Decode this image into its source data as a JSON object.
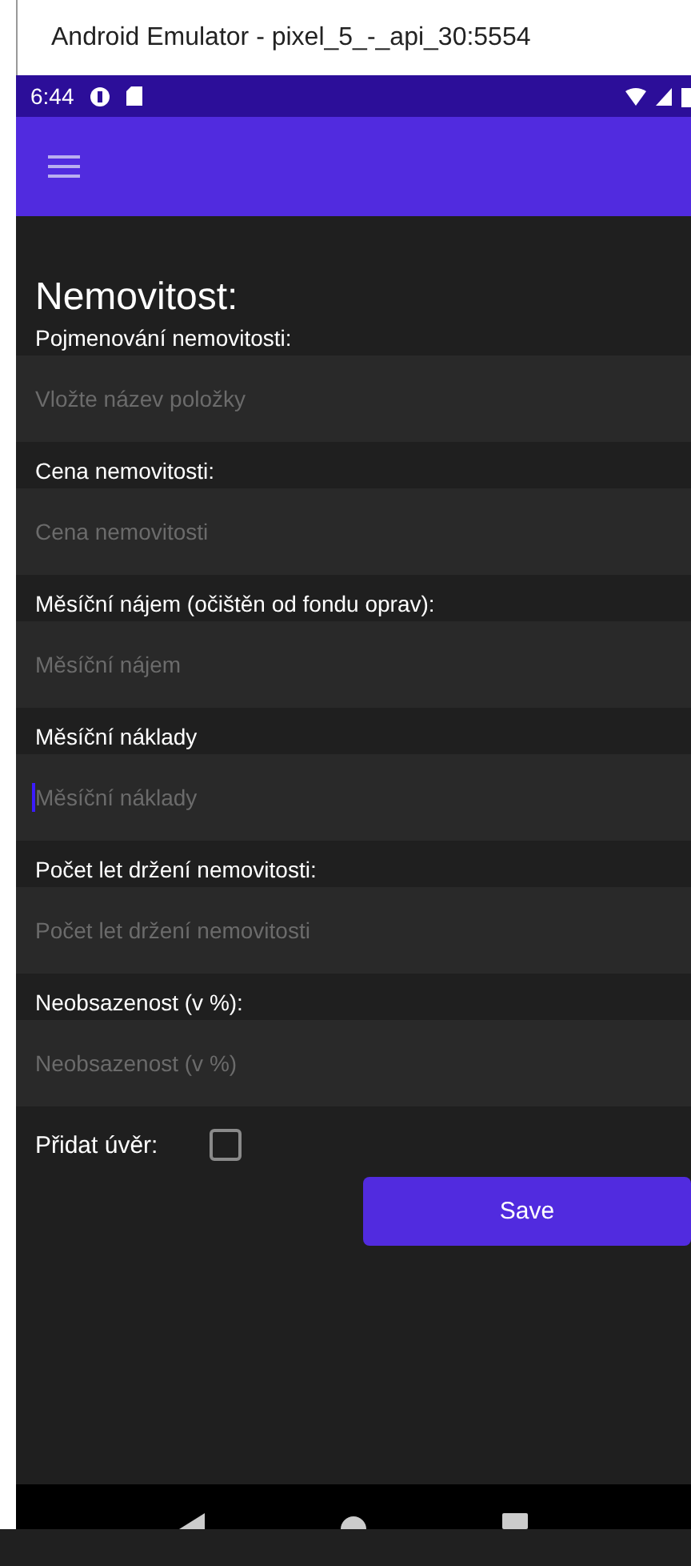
{
  "window": {
    "title": "Android Emulator - pixel_5_-_api_30:5554"
  },
  "status_bar": {
    "time": "6:44"
  },
  "page": {
    "title": "Nemovitost:"
  },
  "fields": [
    {
      "label": "Pojmenování nemovitosti:",
      "placeholder": "Vložte název položky",
      "focused": false
    },
    {
      "label": "Cena nemovitosti:",
      "placeholder": "Cena nemovitosti",
      "focused": false
    },
    {
      "label": "Měsíční nájem (očištěn od fondu oprav):",
      "placeholder": "Měsíční nájem",
      "focused": false
    },
    {
      "label": "Měsíční náklady",
      "placeholder": "Měsíční náklady",
      "focused": true
    },
    {
      "label": "Počet let držení nemovitosti:",
      "placeholder": "Počet let držení nemovitosti",
      "focused": false
    },
    {
      "label": "Neobsazenost (v %):",
      "placeholder": "Neobsazenost (v %)",
      "focused": false
    }
  ],
  "loan": {
    "label": "Přidat úvěr:",
    "checked": false
  },
  "save_button": {
    "label": "Save"
  }
}
